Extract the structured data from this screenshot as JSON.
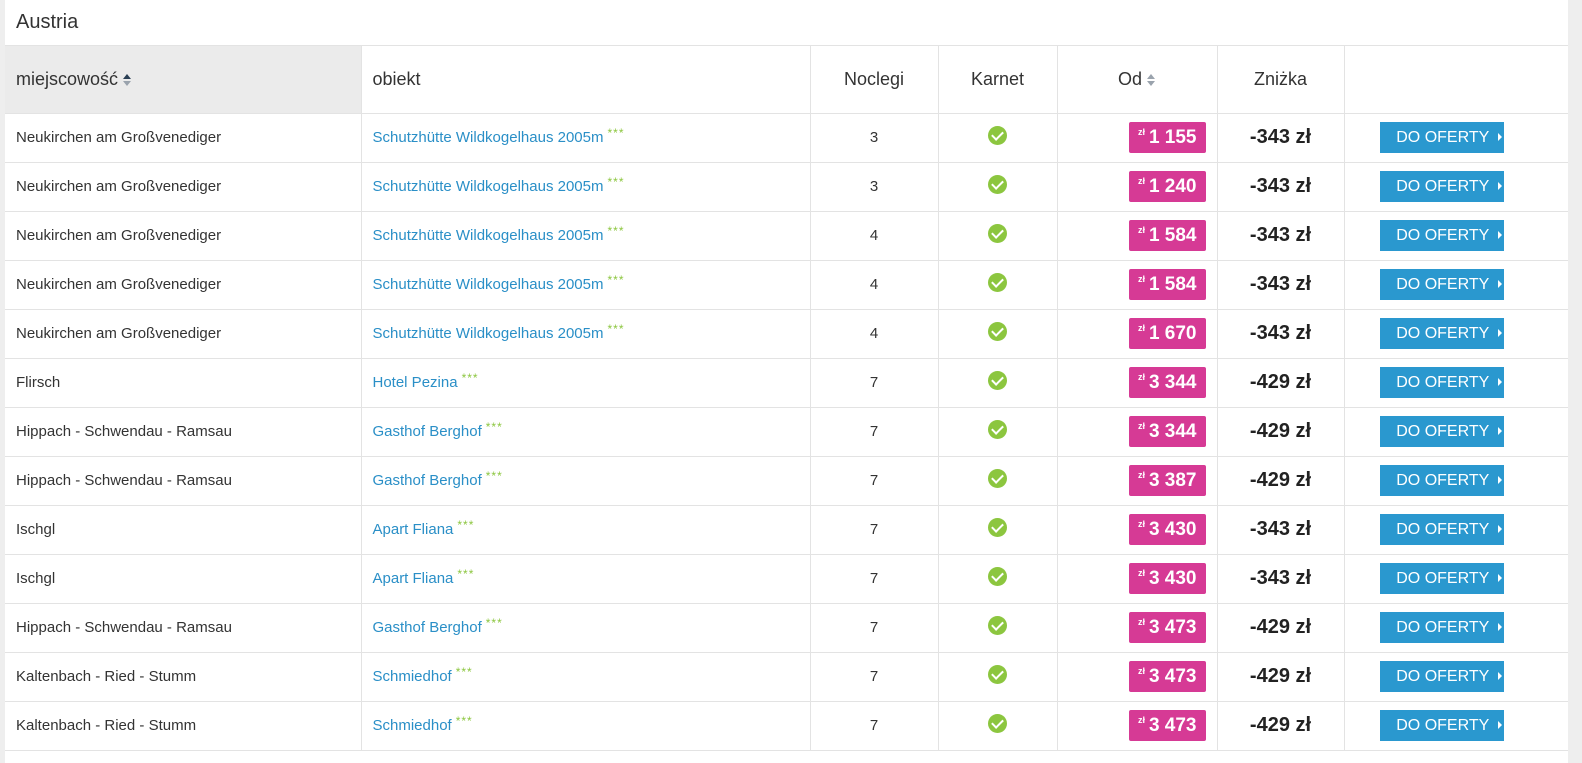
{
  "panel": {
    "title": "Austria"
  },
  "colors": {
    "link": "#2a8fc7",
    "price_badge": "#d63a95",
    "button": "#2a98cf",
    "check": "#8cc63f",
    "stars": "#8cc63f"
  },
  "table": {
    "headers": {
      "town": "miejscowość",
      "hotel": "obiekt",
      "nights": "Noclegi",
      "pass": "Karnet",
      "price": "Od",
      "discount": "Zniżka"
    },
    "currency_symbol": "zł",
    "star_glyph": "***",
    "button_label": "DO OFERTY",
    "rows": [
      {
        "town": "Neukirchen am Großvenediger",
        "hotel": "Schutzhütte Wildkogelhaus 2005m",
        "stars": "***",
        "nights": "3",
        "pass_icon": "check-icon",
        "price": "1 155",
        "discount": "-343 zł"
      },
      {
        "town": "Neukirchen am Großvenediger",
        "hotel": "Schutzhütte Wildkogelhaus 2005m",
        "stars": "***",
        "nights": "3",
        "pass_icon": "check-icon",
        "price": "1 240",
        "discount": "-343 zł"
      },
      {
        "town": "Neukirchen am Großvenediger",
        "hotel": "Schutzhütte Wildkogelhaus 2005m",
        "stars": "***",
        "nights": "4",
        "pass_icon": "check-icon",
        "price": "1 584",
        "discount": "-343 zł"
      },
      {
        "town": "Neukirchen am Großvenediger",
        "hotel": "Schutzhütte Wildkogelhaus 2005m",
        "stars": "***",
        "nights": "4",
        "pass_icon": "check-icon",
        "price": "1 584",
        "discount": "-343 zł"
      },
      {
        "town": "Neukirchen am Großvenediger",
        "hotel": "Schutzhütte Wildkogelhaus 2005m",
        "stars": "***",
        "nights": "4",
        "pass_icon": "check-icon",
        "price": "1 670",
        "discount": "-343 zł"
      },
      {
        "town": "Flirsch",
        "hotel": "Hotel Pezina",
        "stars": "***",
        "nights": "7",
        "pass_icon": "check-icon",
        "price": "3 344",
        "discount": "-429 zł"
      },
      {
        "town": "Hippach - Schwendau - Ramsau",
        "hotel": "Gasthof Berghof",
        "stars": "***",
        "nights": "7",
        "pass_icon": "check-icon",
        "price": "3 344",
        "discount": "-429 zł"
      },
      {
        "town": "Hippach - Schwendau - Ramsau",
        "hotel": "Gasthof Berghof",
        "stars": "***",
        "nights": "7",
        "pass_icon": "check-icon",
        "price": "3 387",
        "discount": "-429 zł"
      },
      {
        "town": "Ischgl",
        "hotel": "Apart Fliana",
        "stars": "***",
        "nights": "7",
        "pass_icon": "check-icon",
        "price": "3 430",
        "discount": "-343 zł"
      },
      {
        "town": "Ischgl",
        "hotel": "Apart Fliana",
        "stars": "***",
        "nights": "7",
        "pass_icon": "check-icon",
        "price": "3 430",
        "discount": "-343 zł"
      },
      {
        "town": "Hippach - Schwendau - Ramsau",
        "hotel": "Gasthof Berghof",
        "stars": "***",
        "nights": "7",
        "pass_icon": "check-icon",
        "price": "3 473",
        "discount": "-429 zł"
      },
      {
        "town": "Kaltenbach - Ried - Stumm",
        "hotel": "Schmiedhof",
        "stars": "***",
        "nights": "7",
        "pass_icon": "check-icon",
        "price": "3 473",
        "discount": "-429 zł"
      },
      {
        "town": "Kaltenbach - Ried - Stumm",
        "hotel": "Schmiedhof",
        "stars": "***",
        "nights": "7",
        "pass_icon": "check-icon",
        "price": "3 473",
        "discount": "-429 zł"
      }
    ]
  }
}
